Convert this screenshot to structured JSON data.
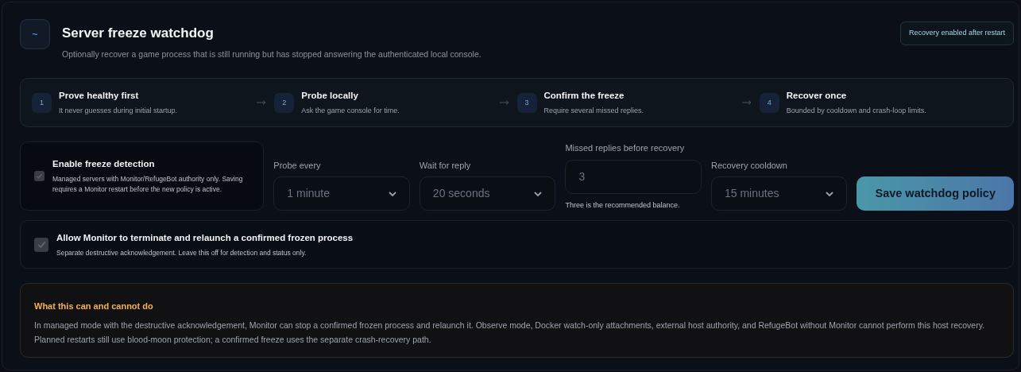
{
  "header": {
    "icon_glyph": "~",
    "title": "Server freeze watchdog",
    "subtitle": "Optionally recover a game process that is still running but has stopped answering the authenticated local console.",
    "badge": "Recovery enabled after restart"
  },
  "steps": [
    {
      "number": "1",
      "title": "Prove healthy first",
      "text": "It never guesses during initial startup."
    },
    {
      "number": "2",
      "title": "Probe locally",
      "text": "Ask the game console for time."
    },
    {
      "number": "3",
      "title": "Confirm the freeze",
      "text": "Require several missed replies."
    },
    {
      "number": "4",
      "title": "Recover once",
      "text": "Bounded by cooldown and crash-loop limits."
    }
  ],
  "detection": {
    "title": "Enable freeze detection",
    "text": "Managed servers with Monitor/RefugeBot authority only. Saving requires a Monitor restart before the new policy is active.",
    "checked": true,
    "disabled": true
  },
  "fields": [
    {
      "kind": "select",
      "label": "Probe every",
      "value": "1 minute",
      "disabled": true
    },
    {
      "kind": "select",
      "label": "Wait for reply",
      "value": "20 seconds",
      "disabled": true
    },
    {
      "kind": "number",
      "label": "Missed replies before recovery",
      "value": "3",
      "hint": "Three is the recommended balance.",
      "disabled": true
    },
    {
      "kind": "select",
      "label": "Recovery cooldown",
      "value": "15 minutes",
      "disabled": true
    }
  ],
  "save_button": "Save watchdog policy",
  "acknowledgement": {
    "title": "Allow Monitor to terminate and relaunch a confirmed frozen process",
    "text": "Separate destructive acknowledgement. Leave this off for detection and status only.",
    "checked": true,
    "disabled": true
  },
  "notice": {
    "title": "What this can and cannot do",
    "text": "In managed mode with the destructive acknowledgement, Monitor can stop a confirmed frozen process and relaunch it. Observe mode, Docker watch-only attachments, external host authority, and RefugeBot without Monitor cannot perform this host recovery. Planned restarts still use blood-moon protection; a confirmed freeze uses the separate crash-recovery path."
  }
}
